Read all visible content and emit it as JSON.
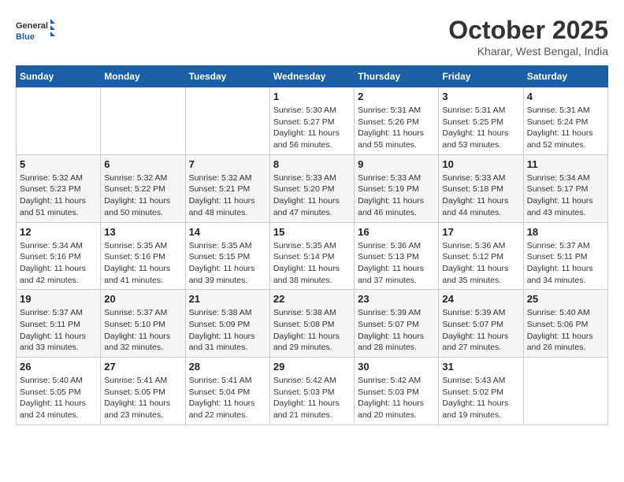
{
  "logo": {
    "line1": "General",
    "line2": "Blue"
  },
  "title": "October 2025",
  "location": "Kharar, West Bengal, India",
  "days_of_week": [
    "Sunday",
    "Monday",
    "Tuesday",
    "Wednesday",
    "Thursday",
    "Friday",
    "Saturday"
  ],
  "weeks": [
    [
      {
        "day": "",
        "info": ""
      },
      {
        "day": "",
        "info": ""
      },
      {
        "day": "",
        "info": ""
      },
      {
        "day": "1",
        "sunrise": "5:30 AM",
        "sunset": "5:27 PM",
        "daylight": "11 hours and 56 minutes."
      },
      {
        "day": "2",
        "sunrise": "5:31 AM",
        "sunset": "5:26 PM",
        "daylight": "11 hours and 55 minutes."
      },
      {
        "day": "3",
        "sunrise": "5:31 AM",
        "sunset": "5:25 PM",
        "daylight": "11 hours and 53 minutes."
      },
      {
        "day": "4",
        "sunrise": "5:31 AM",
        "sunset": "5:24 PM",
        "daylight": "11 hours and 52 minutes."
      }
    ],
    [
      {
        "day": "5",
        "sunrise": "5:32 AM",
        "sunset": "5:23 PM",
        "daylight": "11 hours and 51 minutes."
      },
      {
        "day": "6",
        "sunrise": "5:32 AM",
        "sunset": "5:22 PM",
        "daylight": "11 hours and 50 minutes."
      },
      {
        "day": "7",
        "sunrise": "5:32 AM",
        "sunset": "5:21 PM",
        "daylight": "11 hours and 48 minutes."
      },
      {
        "day": "8",
        "sunrise": "5:33 AM",
        "sunset": "5:20 PM",
        "daylight": "11 hours and 47 minutes."
      },
      {
        "day": "9",
        "sunrise": "5:33 AM",
        "sunset": "5:19 PM",
        "daylight": "11 hours and 46 minutes."
      },
      {
        "day": "10",
        "sunrise": "5:33 AM",
        "sunset": "5:18 PM",
        "daylight": "11 hours and 44 minutes."
      },
      {
        "day": "11",
        "sunrise": "5:34 AM",
        "sunset": "5:17 PM",
        "daylight": "11 hours and 43 minutes."
      }
    ],
    [
      {
        "day": "12",
        "sunrise": "5:34 AM",
        "sunset": "5:16 PM",
        "daylight": "11 hours and 42 minutes."
      },
      {
        "day": "13",
        "sunrise": "5:35 AM",
        "sunset": "5:16 PM",
        "daylight": "11 hours and 41 minutes."
      },
      {
        "day": "14",
        "sunrise": "5:35 AM",
        "sunset": "5:15 PM",
        "daylight": "11 hours and 39 minutes."
      },
      {
        "day": "15",
        "sunrise": "5:35 AM",
        "sunset": "5:14 PM",
        "daylight": "11 hours and 38 minutes."
      },
      {
        "day": "16",
        "sunrise": "5:36 AM",
        "sunset": "5:13 PM",
        "daylight": "11 hours and 37 minutes."
      },
      {
        "day": "17",
        "sunrise": "5:36 AM",
        "sunset": "5:12 PM",
        "daylight": "11 hours and 35 minutes."
      },
      {
        "day": "18",
        "sunrise": "5:37 AM",
        "sunset": "5:11 PM",
        "daylight": "11 hours and 34 minutes."
      }
    ],
    [
      {
        "day": "19",
        "sunrise": "5:37 AM",
        "sunset": "5:11 PM",
        "daylight": "11 hours and 33 minutes."
      },
      {
        "day": "20",
        "sunrise": "5:37 AM",
        "sunset": "5:10 PM",
        "daylight": "11 hours and 32 minutes."
      },
      {
        "day": "21",
        "sunrise": "5:38 AM",
        "sunset": "5:09 PM",
        "daylight": "11 hours and 31 minutes."
      },
      {
        "day": "22",
        "sunrise": "5:38 AM",
        "sunset": "5:08 PM",
        "daylight": "11 hours and 29 minutes."
      },
      {
        "day": "23",
        "sunrise": "5:39 AM",
        "sunset": "5:07 PM",
        "daylight": "11 hours and 28 minutes."
      },
      {
        "day": "24",
        "sunrise": "5:39 AM",
        "sunset": "5:07 PM",
        "daylight": "11 hours and 27 minutes."
      },
      {
        "day": "25",
        "sunrise": "5:40 AM",
        "sunset": "5:06 PM",
        "daylight": "11 hours and 26 minutes."
      }
    ],
    [
      {
        "day": "26",
        "sunrise": "5:40 AM",
        "sunset": "5:05 PM",
        "daylight": "11 hours and 24 minutes."
      },
      {
        "day": "27",
        "sunrise": "5:41 AM",
        "sunset": "5:05 PM",
        "daylight": "11 hours and 23 minutes."
      },
      {
        "day": "28",
        "sunrise": "5:41 AM",
        "sunset": "5:04 PM",
        "daylight": "11 hours and 22 minutes."
      },
      {
        "day": "29",
        "sunrise": "5:42 AM",
        "sunset": "5:03 PM",
        "daylight": "11 hours and 21 minutes."
      },
      {
        "day": "30",
        "sunrise": "5:42 AM",
        "sunset": "5:03 PM",
        "daylight": "11 hours and 20 minutes."
      },
      {
        "day": "31",
        "sunrise": "5:43 AM",
        "sunset": "5:02 PM",
        "daylight": "11 hours and 19 minutes."
      },
      {
        "day": "",
        "info": ""
      }
    ]
  ]
}
